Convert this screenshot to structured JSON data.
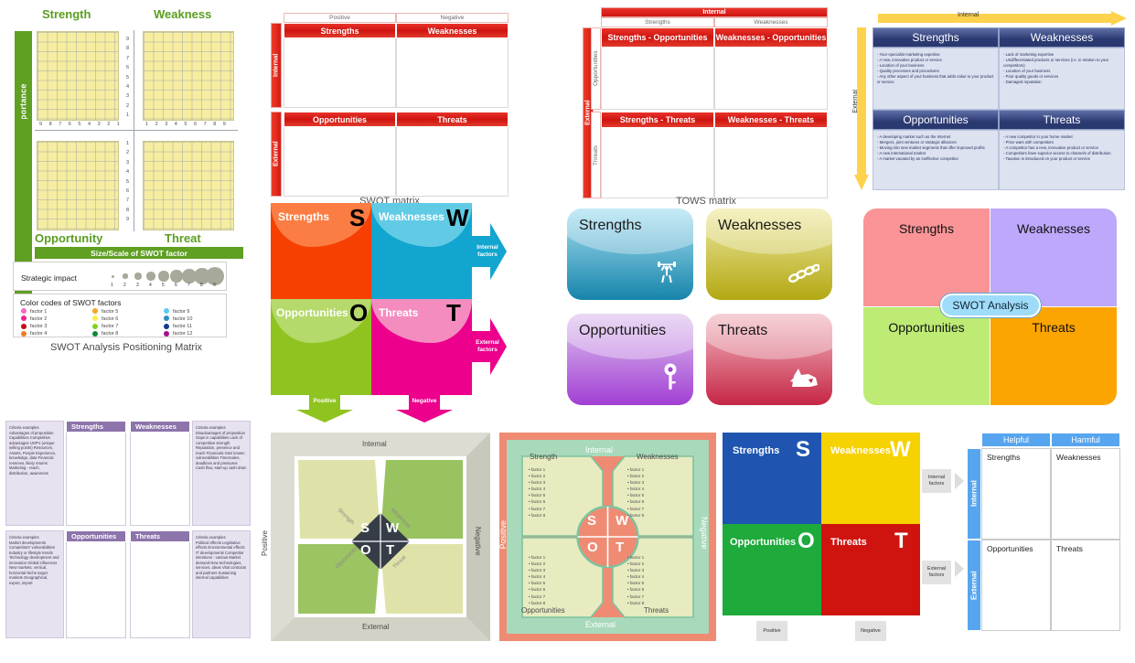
{
  "positioning_matrix": {
    "title_top_left": "Strength",
    "title_top_right": "Weakness",
    "title_bottom_left": "Opportunity",
    "title_bottom_right": "Threat",
    "y_axis_label": "Relevance/Importance",
    "x_axis_label": "Size/Scale of SWOT factor",
    "axis_ticks_left": [
      "9",
      "8",
      "7",
      "6",
      "5",
      "4",
      "3",
      "2",
      "1"
    ],
    "axis_ticks_right": [
      "1",
      "2",
      "3",
      "4",
      "5",
      "6",
      "7",
      "8",
      "9"
    ],
    "axis_ticks_up": [
      "9",
      "8",
      "7",
      "6",
      "5",
      "4",
      "3",
      "2",
      "1"
    ],
    "axis_ticks_down": [
      "1",
      "2",
      "3",
      "4",
      "5",
      "6",
      "7",
      "8",
      "9"
    ],
    "impact_label": "Strategic impact",
    "impact_scale": [
      "1",
      "2",
      "3",
      "4",
      "5",
      "6",
      "7",
      "8",
      "9"
    ],
    "legend_title": "Color codes of SWOT factors",
    "legend": [
      {
        "label": "factor 1",
        "color": "#f06ec4"
      },
      {
        "label": "factor 2",
        "color": "#ec268f"
      },
      {
        "label": "factor 3",
        "color": "#c20a16"
      },
      {
        "label": "factor 4",
        "color": "#f47920"
      },
      {
        "label": "factor 5",
        "color": "#f5a623"
      },
      {
        "label": "factor 6",
        "color": "#fced4e"
      },
      {
        "label": "factor 7",
        "color": "#7ed321"
      },
      {
        "label": "factor 8",
        "color": "#0e8a37"
      },
      {
        "label": "factor 9",
        "color": "#5ecbf0"
      },
      {
        "label": "factor 10",
        "color": "#2e8ec4"
      },
      {
        "label": "factor 11",
        "color": "#123a8f"
      },
      {
        "label": "factor 12",
        "color": "#a4118c"
      }
    ],
    "caption": "SWOT Analysis Positioning Matrix"
  },
  "swot_matrix": {
    "caption": "SWOT matrix",
    "col_headers": [
      "Positive",
      "Negative"
    ],
    "row_headers": [
      "Internal",
      "External"
    ],
    "cells": [
      "Strengths",
      "Weaknesses",
      "Opportunities",
      "Threats"
    ],
    "accent": "#cf1410"
  },
  "tows_matrix": {
    "caption": "TOWS matrix",
    "top_banner": "Internal",
    "side_banner": "External",
    "col_headers": [
      "Strengths",
      "Weaknesses"
    ],
    "row_headers": [
      "Opportunities",
      "Threats"
    ],
    "cells": [
      "Strengths - Opportunities",
      "Weaknesses - Opportunities",
      "Strengths - Threats",
      "Weaknesses - Threats"
    ],
    "accent": "#cf1410"
  },
  "blue_swot": {
    "top_arrow_label": "Internal",
    "left_arrow_label": "External",
    "quadrants": [
      {
        "title": "Strengths",
        "items": [
          "- Your specialist marketing expertise",
          "- A new, innovative product or  service",
          "- Location of your business",
          "- Quality processes and procedures",
          "- Any other aspect of your business that adds value to your product or service"
        ]
      },
      {
        "title": "Weaknesses",
        "items": [
          "- Lack of marketing expertise",
          "- Undifferentiated products or services (i.e. in relation to your  competitors)",
          "- Location of your business",
          "- Poor quality goods or services",
          "- Damaged reputation"
        ]
      },
      {
        "title": "Opportunities",
        "items": [
          "- A developing market such as the Internet",
          "- Mergers, joint ventures or strategic alliances",
          "- Moving into new market segments that offer improved profits",
          "- A new international market",
          "- A market vacated by an ineffective competitor"
        ]
      },
      {
        "title": "Threats",
        "items": [
          "- A new competitor in your home market",
          "- Price wars with competitors",
          "- A competitor has a new, innovative product or service",
          "- Competitors have superior access to channels of distribution",
          "- Taxation is introduced on your product or service"
        ]
      }
    ],
    "arrow_color": "#ffd24d",
    "header_color": "#2a3870"
  },
  "arrow_swot": {
    "quadrants": [
      {
        "label": "Strengths",
        "letter": "S",
        "color": "#f63f00",
        "light": "#fc7d43",
        "letter_color": "#000000"
      },
      {
        "label": "Weaknesses",
        "letter": "W",
        "color": "#12a5cf",
        "light": "#61cbe6",
        "letter_color": "#000000"
      },
      {
        "label": "Opportunities",
        "letter": "O",
        "color": "#8fc31f",
        "light": "#b5d96a",
        "letter_color": "#000000"
      },
      {
        "label": "Threats",
        "letter": "T",
        "color": "#ec008c",
        "light": "#f48cc0",
        "letter_color": "#000000"
      }
    ],
    "right_arrows": [
      "Internal factors",
      "External factors"
    ],
    "bottom_arrows": [
      "Positive",
      "Negative"
    ]
  },
  "tiles": [
    {
      "label": "Strengths",
      "icon": "weightlifter-icon",
      "glyph": "🏋",
      "c1": "#a9e0f2",
      "c2": "#1684ab"
    },
    {
      "label": "Weaknesses",
      "icon": "broken-chain-icon",
      "glyph": "⛓",
      "c1": "#efeaa3",
      "c2": "#b3a812"
    },
    {
      "label": "Opportunities",
      "icon": "key-icon",
      "glyph": "🗝",
      "c1": "#e0c6ef",
      "c2": "#a13fd4"
    },
    {
      "label": "Threats",
      "icon": "dog-icon",
      "glyph": "🐺",
      "c1": "#f2bac3",
      "c2": "#c62645"
    }
  ],
  "pastel_swot": {
    "center_badge": "SWOT Analysis",
    "quadrants": [
      {
        "label": "Strengths",
        "color": "#fa9496"
      },
      {
        "label": "Weaknesses",
        "color": "#bda8fb"
      },
      {
        "label": "Opportunities",
        "color": "#bdeb74"
      },
      {
        "label": "Threats",
        "color": "#fca400"
      }
    ],
    "badge_color": "#9fdcfa"
  },
  "criteria_table": {
    "headers": [
      "Strengths",
      "Weaknesses",
      "Opportunities",
      "Threats"
    ],
    "header_color": "#8d74ab",
    "criteria": [
      {
        "title": "Criteria examples",
        "text": "Advantages of proposition Capabilities Competitive advantages USP's (unique selling points) Resources, Assets, People Experience, knowledge, data Financial reserves, likely returns Marketing - reach, distribution, awareness"
      },
      {
        "title": "Criteria examples",
        "text": "Disadvantages of proposition Gaps in capabilities Lack of competitive strength Reputation, presence and reach Financials Own known vulnerabilities Timescales, deadlines and pressures Cash flow, start-up cash-drain"
      },
      {
        "title": "Criteria examples",
        "text": "Market developments Competitors' vulnerabilities Industry or lifestyle trends Technology development and innovation Global influences New markets, vertical, horizontal Niche target markets Geographical, export, import"
      },
      {
        "title": "Criteria examples",
        "text": "Political effects Legislative effects Environmental effects IT developments Competitor intentions - various Market demand New technologies, services, ideas Vital contracts and partners Sustaining internal capabilities"
      }
    ]
  },
  "pinwheel": {
    "edges": {
      "top": "Internal",
      "bottom": "External",
      "left": "Positive",
      "right": "Negative"
    },
    "diamond_letters": [
      "S",
      "W",
      "O",
      "T"
    ],
    "diamond_labels": [
      "Strength",
      "Weakness",
      "Opportunity",
      "Threat"
    ],
    "petal_colors": [
      "#dfe2a8",
      "#99c261",
      "#9cc463",
      "#e0e3a9"
    ],
    "frame_color": "#d2d2c6",
    "core_color": "#373d47"
  },
  "factor_wheel": {
    "edges": {
      "top": "Internal",
      "bottom": "External",
      "left": "Positive",
      "right": "Negative"
    },
    "quadrant_titles": [
      "Strength",
      "Weaknesses",
      "Opportunities",
      "Threats"
    ],
    "factors": [
      "factor 1",
      "factor 2",
      "factor 3",
      "factor 4",
      "factor 5",
      "factor 6",
      "factor 7",
      "factor 8"
    ],
    "letters": [
      "S",
      "W",
      "O",
      "T"
    ],
    "frame_color": "#ef8b73",
    "band_color": "#a8d9bb",
    "panel_color": "#e8ebc0"
  },
  "primary_swot": {
    "quadrants": [
      {
        "label": "Strengths",
        "letter": "S",
        "color": "#1f55b0"
      },
      {
        "label": "Weaknesses",
        "letter": "W",
        "color": "#f5d200"
      },
      {
        "label": "Opportunities",
        "letter": "O",
        "color": "#1faa3c"
      },
      {
        "label": "Threats",
        "letter": "T",
        "color": "#cf1410"
      }
    ],
    "right_tags": [
      "Internal factors",
      "External factors"
    ],
    "bottom_tags": [
      "Positive",
      "Negative"
    ]
  },
  "helpful_harmful": {
    "col_headers": [
      "Helpful",
      "Harmful"
    ],
    "row_headers": [
      "Internal",
      "External"
    ],
    "cells": [
      "Strengths",
      "Weaknesses",
      "Opportunities",
      "Threats"
    ],
    "accent": "#56a5ee"
  }
}
